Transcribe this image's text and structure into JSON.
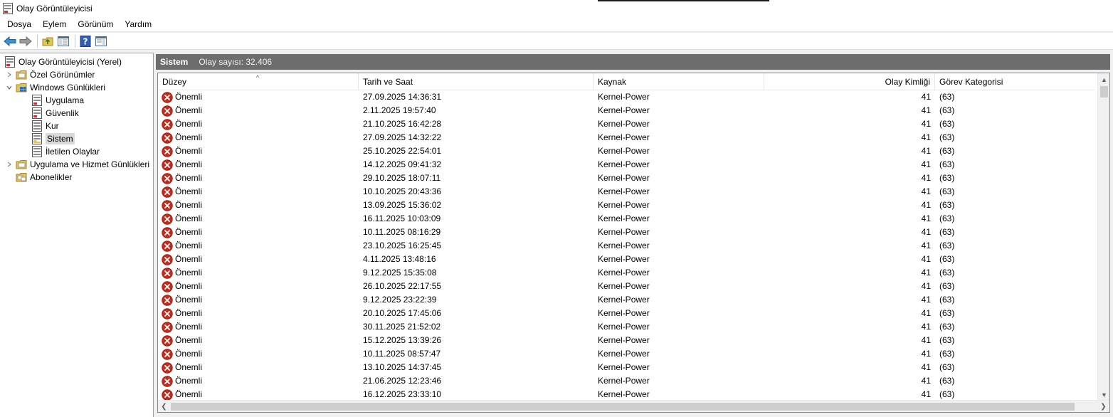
{
  "window": {
    "title": "Olay Görüntüleyicisi"
  },
  "menu": [
    "Dosya",
    "Eylem",
    "Görünüm",
    "Yardım"
  ],
  "toolbar": {
    "buttons": [
      "back-arrow-icon",
      "forward-arrow-icon",
      "folder-up-icon",
      "show-hide-console-tree-icon",
      "help-icon",
      "show-hide-action-pane-icon"
    ]
  },
  "tree": {
    "root": "Olay Görüntüleyicisi (Yerel)",
    "custom_views": "Özel Görünümler",
    "windows_logs": "Windows Günlükleri",
    "logs": [
      "Uygulama",
      "Güvenlik",
      "Kur",
      "Sistem",
      "İletilen Olaylar"
    ],
    "selected": "Sistem",
    "app_service_logs": "Uygulama ve Hizmet Günlükleri",
    "subscriptions": "Abonelikler"
  },
  "pane_header": {
    "title": "Sistem",
    "count_label": "Olay sayısı: 32.406"
  },
  "columns": [
    "Düzey",
    "Tarih ve Saat",
    "Kaynak",
    "Olay Kimliği",
    "Görev Kategorisi"
  ],
  "colors": {
    "error_red": "#c42b1c",
    "header_gray": "#6d6d6d",
    "selection_gray": "#d9d9d9"
  },
  "rows": [
    {
      "level": "Önemli",
      "datetime": "27.09.2025 14:36:31",
      "source": "Kernel-Power",
      "event_id": "41",
      "category": "(63)"
    },
    {
      "level": "Önemli",
      "datetime": "2.11.2025 19:57:40",
      "source": "Kernel-Power",
      "event_id": "41",
      "category": "(63)"
    },
    {
      "level": "Önemli",
      "datetime": "21.10.2025 16:42:28",
      "source": "Kernel-Power",
      "event_id": "41",
      "category": "(63)"
    },
    {
      "level": "Önemli",
      "datetime": "27.09.2025 14:32:22",
      "source": "Kernel-Power",
      "event_id": "41",
      "category": "(63)"
    },
    {
      "level": "Önemli",
      "datetime": "25.10.2025 22:54:01",
      "source": "Kernel-Power",
      "event_id": "41",
      "category": "(63)"
    },
    {
      "level": "Önemli",
      "datetime": "14.12.2025 09:41:32",
      "source": "Kernel-Power",
      "event_id": "41",
      "category": "(63)"
    },
    {
      "level": "Önemli",
      "datetime": "29.10.2025 18:07:11",
      "source": "Kernel-Power",
      "event_id": "41",
      "category": "(63)"
    },
    {
      "level": "Önemli",
      "datetime": "10.10.2025 20:43:36",
      "source": "Kernel-Power",
      "event_id": "41",
      "category": "(63)"
    },
    {
      "level": "Önemli",
      "datetime": "13.09.2025 15:36:02",
      "source": "Kernel-Power",
      "event_id": "41",
      "category": "(63)"
    },
    {
      "level": "Önemli",
      "datetime": "16.11.2025 10:03:09",
      "source": "Kernel-Power",
      "event_id": "41",
      "category": "(63)"
    },
    {
      "level": "Önemli",
      "datetime": "10.11.2025 08:16:29",
      "source": "Kernel-Power",
      "event_id": "41",
      "category": "(63)"
    },
    {
      "level": "Önemli",
      "datetime": "23.10.2025 16:25:45",
      "source": "Kernel-Power",
      "event_id": "41",
      "category": "(63)"
    },
    {
      "level": "Önemli",
      "datetime": "4.11.2025 13:48:16",
      "source": "Kernel-Power",
      "event_id": "41",
      "category": "(63)"
    },
    {
      "level": "Önemli",
      "datetime": "9.12.2025 15:35:08",
      "source": "Kernel-Power",
      "event_id": "41",
      "category": "(63)"
    },
    {
      "level": "Önemli",
      "datetime": "26.10.2025 22:17:55",
      "source": "Kernel-Power",
      "event_id": "41",
      "category": "(63)"
    },
    {
      "level": "Önemli",
      "datetime": "9.12.2025 23:22:39",
      "source": "Kernel-Power",
      "event_id": "41",
      "category": "(63)"
    },
    {
      "level": "Önemli",
      "datetime": "20.10.2025 17:45:06",
      "source": "Kernel-Power",
      "event_id": "41",
      "category": "(63)"
    },
    {
      "level": "Önemli",
      "datetime": "30.11.2025 21:52:02",
      "source": "Kernel-Power",
      "event_id": "41",
      "category": "(63)"
    },
    {
      "level": "Önemli",
      "datetime": "15.12.2025 13:39:26",
      "source": "Kernel-Power",
      "event_id": "41",
      "category": "(63)"
    },
    {
      "level": "Önemli",
      "datetime": "10.11.2025 08:57:47",
      "source": "Kernel-Power",
      "event_id": "41",
      "category": "(63)"
    },
    {
      "level": "Önemli",
      "datetime": "13.10.2025 14:37:45",
      "source": "Kernel-Power",
      "event_id": "41",
      "category": "(63)"
    },
    {
      "level": "Önemli",
      "datetime": "21.06.2025 12:23:46",
      "source": "Kernel-Power",
      "event_id": "41",
      "category": "(63)"
    },
    {
      "level": "Önemli",
      "datetime": "16.12.2025 23:33:10",
      "source": "Kernel-Power",
      "event_id": "41",
      "category": "(63)"
    }
  ]
}
